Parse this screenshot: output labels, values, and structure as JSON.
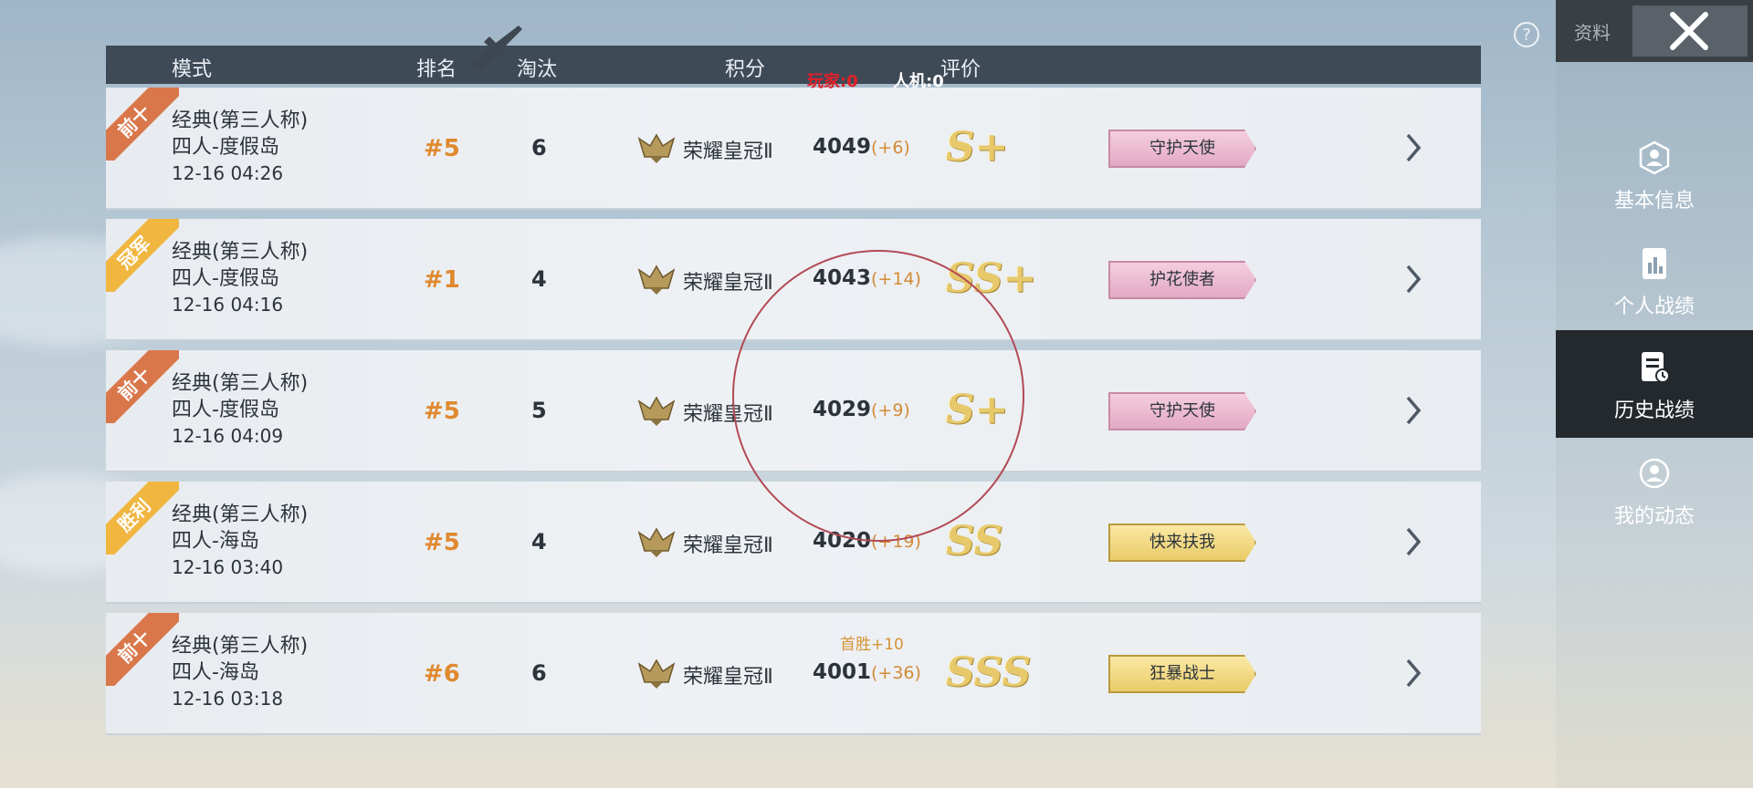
{
  "header": {
    "mode": "模式",
    "rank": "排名",
    "kills": "淘汰",
    "score": "积分",
    "rating": "评价"
  },
  "overlay": {
    "players": "玩家:0",
    "bots": "人机:0"
  },
  "sidebar": {
    "top_label": "资料",
    "items": [
      {
        "label": "基本信息",
        "icon": "profile-icon"
      },
      {
        "label": "个人战绩",
        "icon": "stats-icon"
      },
      {
        "label": "历史战绩",
        "icon": "history-icon",
        "active": true
      },
      {
        "label": "我的动态",
        "icon": "moments-icon"
      }
    ]
  },
  "matches": [
    {
      "ribbon": "前十",
      "ribbon_color": "#d9774b",
      "mode": "经典(第三人称)",
      "map": "四人-度假岛",
      "date": "12-16 04:26",
      "rank": "#5",
      "kills": "6",
      "tier": "荣耀皇冠Ⅱ",
      "score": "4049",
      "delta": "(+6)",
      "bonus": "",
      "grade": "S+",
      "title": "守护天使",
      "title_style": "pink"
    },
    {
      "ribbon": "冠军",
      "ribbon_color": "#f0b640",
      "mode": "经典(第三人称)",
      "map": "四人-度假岛",
      "date": "12-16 04:16",
      "rank": "#1",
      "kills": "4",
      "tier": "荣耀皇冠Ⅱ",
      "score": "4043",
      "delta": "(+14)",
      "bonus": "",
      "grade": "SS+",
      "title": "护花使者",
      "title_style": "pink"
    },
    {
      "ribbon": "前十",
      "ribbon_color": "#d9774b",
      "mode": "经典(第三人称)",
      "map": "四人-度假岛",
      "date": "12-16 04:09",
      "rank": "#5",
      "kills": "5",
      "tier": "荣耀皇冠Ⅱ",
      "score": "4029",
      "delta": "(+9)",
      "bonus": "",
      "grade": "S+",
      "title": "守护天使",
      "title_style": "pink"
    },
    {
      "ribbon": "胜利",
      "ribbon_color": "#f0b640",
      "mode": "经典(第三人称)",
      "map": "四人-海岛",
      "date": "12-16 03:40",
      "rank": "#5",
      "kills": "4",
      "tier": "荣耀皇冠Ⅱ",
      "score": "4020",
      "delta": "(+19)",
      "bonus": "",
      "grade": "SS",
      "title": "快来扶我",
      "title_style": "yellow"
    },
    {
      "ribbon": "前十",
      "ribbon_color": "#d9774b",
      "mode": "经典(第三人称)",
      "map": "四人-海岛",
      "date": "12-16 03:18",
      "rank": "#6",
      "kills": "6",
      "tier": "荣耀皇冠Ⅱ",
      "score": "4001",
      "delta": "(+36)",
      "bonus": "首胜+10",
      "grade": "SSS",
      "title": "狂暴战士",
      "title_style": "yellow"
    }
  ]
}
